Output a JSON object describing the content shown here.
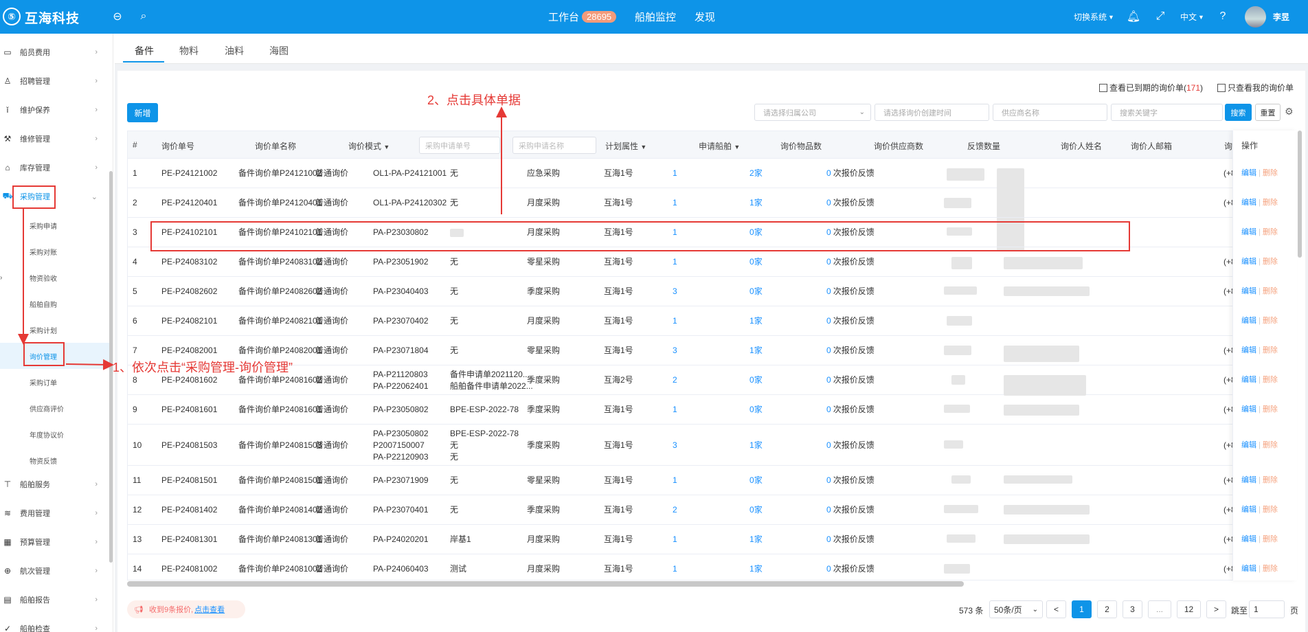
{
  "header": {
    "brand": "互海科技",
    "nav": {
      "workbench": "工作台",
      "workbench_badge": "28695",
      "ship_monitor": "船舶监控",
      "discover": "发现"
    },
    "switch_system": "切换系统",
    "language": "中文",
    "user": "李昱"
  },
  "sidebar": {
    "items": [
      {
        "label": "船员费用",
        "icon": "wallet-icon"
      },
      {
        "label": "招聘管理",
        "icon": "user-icon"
      },
      {
        "label": "维护保养",
        "icon": "wrench-icon"
      },
      {
        "label": "维修管理",
        "icon": "tool-icon"
      },
      {
        "label": "库存管理",
        "icon": "warehouse-icon"
      },
      {
        "label": "采购管理",
        "icon": "cart-icon"
      }
    ],
    "subitems": [
      "采购申请",
      "采购对账",
      "物资验收",
      "船舶自购",
      "采购计划",
      "询价管理",
      "采购订单",
      "供应商评价",
      "年度协议价",
      "物资反馈"
    ],
    "items_after": [
      {
        "label": "船舶服务",
        "icon": "hammer-icon"
      },
      {
        "label": "费用管理",
        "icon": "database-icon"
      },
      {
        "label": "预算管理",
        "icon": "calculator-icon"
      },
      {
        "label": "航次管理",
        "icon": "globe-icon"
      },
      {
        "label": "船舶报告",
        "icon": "report-icon"
      },
      {
        "label": "船舶检查",
        "icon": "check-icon"
      }
    ]
  },
  "tabs": [
    "备件",
    "物料",
    "油料",
    "海图"
  ],
  "toolbar": {
    "expired_check_prefix": "查看已到期的询价单(",
    "expired_count": "171",
    "expired_check_suffix": ")",
    "mine_check": "只查看我的询价单",
    "new_button": "新增",
    "company_placeholder": "请选择归属公司",
    "date_placeholder": "请选择询价创建时间",
    "supplier_placeholder": "供应商名称",
    "keyword_placeholder": "搜索关键字",
    "search_button": "搜索",
    "reset_button": "重置"
  },
  "table": {
    "headers": [
      "#",
      "询价单号",
      "询价单名称",
      "询价模式",
      "采购申请单号",
      "采购申请名称",
      "计划属性",
      "申请船舶",
      "询价物品数",
      "询价供应商数",
      "反馈数量",
      "询价人姓名",
      "询价人邮箱",
      "询价",
      "操作"
    ],
    "rows": [
      {
        "no": "1",
        "code": "PE-P24121002",
        "name": "备件询价单P24121002",
        "mode": "普通询价",
        "req_no": [
          "OL1-PA-P24121001"
        ],
        "req_name": [
          "无"
        ],
        "plan": "应急采购",
        "ship": "互海1号",
        "items": "1",
        "suppliers": "2",
        "feedback": "0"
      },
      {
        "no": "2",
        "code": "PE-P24120401",
        "name": "备件询价单P24120401",
        "mode": "普通询价",
        "req_no": [
          "OL1-PA-P24120302"
        ],
        "req_name": [
          "无"
        ],
        "plan": "月度采购",
        "ship": "互海1号",
        "items": "1",
        "suppliers": "1",
        "feedback": "0"
      },
      {
        "no": "3",
        "code": "PE-P24102101",
        "name": "备件询价单P24102101",
        "mode": "普通询价",
        "req_no": [
          "PA-P23030802"
        ],
        "req_name": [],
        "plan": "月度采购",
        "ship": "互海1号",
        "items": "1",
        "suppliers": "0",
        "feedback": "0"
      },
      {
        "no": "4",
        "code": "PE-P24083102",
        "name": "备件询价单P24083102",
        "mode": "普通询价",
        "req_no": [
          "PA-P23051902"
        ],
        "req_name": [
          "无"
        ],
        "plan": "零星采购",
        "ship": "互海1号",
        "items": "1",
        "suppliers": "0",
        "feedback": "0"
      },
      {
        "no": "5",
        "code": "PE-P24082602",
        "name": "备件询价单P24082602",
        "mode": "普通询价",
        "req_no": [
          "PA-P23040403"
        ],
        "req_name": [
          "无"
        ],
        "plan": "季度采购",
        "ship": "互海1号",
        "items": "3",
        "suppliers": "0",
        "feedback": "0"
      },
      {
        "no": "6",
        "code": "PE-P24082101",
        "name": "备件询价单P24082101",
        "mode": "普通询价",
        "req_no": [
          "PA-P23070402"
        ],
        "req_name": [
          "无"
        ],
        "plan": "月度采购",
        "ship": "互海1号",
        "items": "1",
        "suppliers": "1",
        "feedback": "0"
      },
      {
        "no": "7",
        "code": "PE-P24082001",
        "name": "备件询价单P24082001",
        "mode": "普通询价",
        "req_no": [
          "PA-P23071804"
        ],
        "req_name": [
          "无"
        ],
        "plan": "零星采购",
        "ship": "互海1号",
        "items": "3",
        "suppliers": "1",
        "feedback": "0"
      },
      {
        "no": "8",
        "code": "PE-P24081602",
        "name": "备件询价单P24081602",
        "mode": "普通询价",
        "req_no": [
          "PA-P21120803",
          "PA-P22062401"
        ],
        "req_name": [
          "备件申请单2021120...",
          "船舶备件申请单2022..."
        ],
        "plan": "季度采购",
        "ship": "互海2号",
        "items": "2",
        "suppliers": "0",
        "feedback": "0"
      },
      {
        "no": "9",
        "code": "PE-P24081601",
        "name": "备件询价单P24081601",
        "mode": "普通询价",
        "req_no": [
          "PA-P23050802"
        ],
        "req_name": [
          "BPE-ESP-2022-78"
        ],
        "plan": "季度采购",
        "ship": "互海1号",
        "items": "1",
        "suppliers": "0",
        "feedback": "0"
      },
      {
        "no": "10",
        "code": "PE-P24081503",
        "name": "备件询价单P24081503",
        "mode": "普通询价",
        "req_no": [
          "PA-P23050802",
          "P2007150007",
          "PA-P22120903"
        ],
        "req_name": [
          "BPE-ESP-2022-78",
          "无",
          "无"
        ],
        "plan": "季度采购",
        "ship": "互海1号",
        "items": "3",
        "suppliers": "1",
        "feedback": "0"
      },
      {
        "no": "11",
        "code": "PE-P24081501",
        "name": "备件询价单P24081501",
        "mode": "普通询价",
        "req_no": [
          "PA-P23071909"
        ],
        "req_name": [
          "无"
        ],
        "plan": "零星采购",
        "ship": "互海1号",
        "items": "1",
        "suppliers": "0",
        "feedback": "0"
      },
      {
        "no": "12",
        "code": "PE-P24081402",
        "name": "备件询价单P24081402",
        "mode": "普通询价",
        "req_no": [
          "PA-P23070401"
        ],
        "req_name": [
          "无"
        ],
        "plan": "季度采购",
        "ship": "互海1号",
        "items": "2",
        "suppliers": "0",
        "feedback": "0"
      },
      {
        "no": "13",
        "code": "PE-P24081301",
        "name": "备件询价单P24081301",
        "mode": "普通询价",
        "req_no": [
          "PA-P24020201"
        ],
        "req_name": [
          "岸基1"
        ],
        "plan": "月度采购",
        "ship": "互海1号",
        "items": "1",
        "suppliers": "1",
        "feedback": "0"
      },
      {
        "no": "14",
        "code": "PE-P24081002",
        "name": "备件询价单P24081002",
        "mode": "普通询价",
        "req_no": [
          "PA-P24060403"
        ],
        "req_name": [
          "测试"
        ],
        "plan": "月度采购",
        "ship": "互海1号",
        "items": "1",
        "suppliers": "1",
        "feedback": "0"
      }
    ],
    "supplier_unit": "家",
    "feedback_suffix": "次报价反馈",
    "phone_prefix": "(+8",
    "op_edit": "编辑",
    "op_sep": "|",
    "op_delete": "删除"
  },
  "footer": {
    "notice_prefix": "收到",
    "notice_count": "9条报价,",
    "notice_link": "点击查看",
    "total": "573 条",
    "page_size": "50条/页",
    "pages": [
      "1",
      "2",
      "3",
      "...",
      "12"
    ],
    "prev": "<",
    "next": ">",
    "goto_label": "跳至",
    "goto_value": "1",
    "goto_suffix": "页"
  },
  "annotations": {
    "step1": "1、依次点击“采购管理-询价管理”",
    "step2": "2、点击具体单据"
  },
  "colors": {
    "primary": "#0e94e8",
    "danger": "#e53935",
    "link": "#1890ff"
  }
}
